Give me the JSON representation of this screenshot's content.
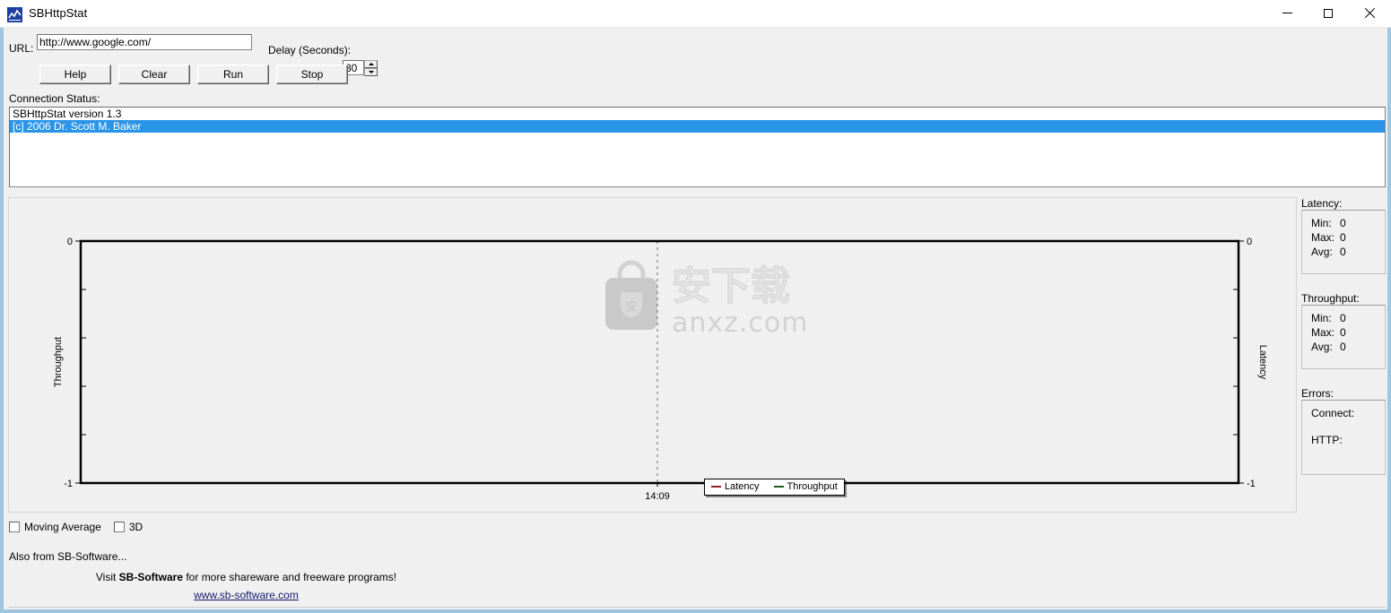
{
  "window": {
    "title": "SBHttpStat",
    "icon": "chart-line-icon",
    "border_color": "#9fc6de",
    "controls": {
      "minimize": "minimize-icon",
      "maximize": "maximize-icon",
      "close": "close-icon"
    }
  },
  "toolbar": {
    "url_label": "URL:",
    "url_value": "http://www.google.com/",
    "url_placeholder": "",
    "delay_label": "Delay (Seconds):",
    "delay_value": "30",
    "buttons": {
      "help": "Help",
      "clear": "Clear",
      "run": "Run",
      "stop": "Stop"
    }
  },
  "connection_status": {
    "label": "Connection Status:",
    "lines": [
      {
        "text": "SBHttpStat version 1.3",
        "selected": false
      },
      {
        "text": "[c] 2006 Dr. Scott M. Baker",
        "selected": true
      }
    ],
    "selection_color": "#2a95e8"
  },
  "chart_data": {
    "type": "line",
    "title": "",
    "xlabel": "",
    "ylabel": "Throughput",
    "y2label": "Latency",
    "x_ticks": [
      "14:09"
    ],
    "y_ticks": [
      "0",
      "-1"
    ],
    "y2_ticks": [
      "0",
      "-1"
    ],
    "ylim": [
      -1,
      0
    ],
    "y2lim": [
      -1,
      0
    ],
    "grid": false,
    "legend_position": "bottom",
    "series": [
      {
        "name": "Latency",
        "color": "#8b2020",
        "axis": "right",
        "values": []
      },
      {
        "name": "Throughput",
        "color": "#1d5c1d",
        "axis": "left",
        "values": []
      }
    ]
  },
  "watermark": {
    "cn_text": "安下载",
    "domain": "anxz.com",
    "badge_char": "安"
  },
  "stats": {
    "latency": {
      "title": "Latency:",
      "rows": [
        {
          "key": "Min:",
          "value": "0"
        },
        {
          "key": "Max:",
          "value": "0"
        },
        {
          "key": "Avg:",
          "value": "0"
        }
      ]
    },
    "throughput": {
      "title": "Throughput:",
      "rows": [
        {
          "key": "Min:",
          "value": "0"
        },
        {
          "key": "Max:",
          "value": "0"
        },
        {
          "key": "Avg:",
          "value": "0"
        }
      ]
    },
    "errors": {
      "title": "Errors:",
      "rows": [
        {
          "key": "Connect:",
          "value": ""
        },
        {
          "key": "HTTP:",
          "value": ""
        }
      ]
    }
  },
  "options": {
    "moving_average": "Moving Average",
    "three_d": "3D",
    "moving_average_checked": false,
    "three_d_checked": false
  },
  "footer": {
    "also_label": "Also from SB-Software...",
    "promo_prefix": "Visit ",
    "promo_brand": "SB-Software",
    "promo_suffix": " for more shareware and freeware programs!",
    "promo_link": "www.sb-software.com"
  }
}
